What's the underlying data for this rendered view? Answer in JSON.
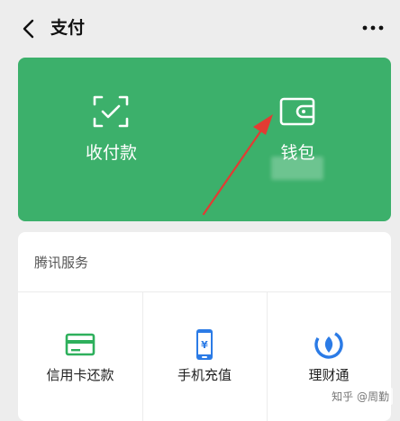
{
  "header": {
    "title": "支付"
  },
  "pay_card": {
    "items": [
      {
        "label": "收付款",
        "icon": "scan-code-icon"
      },
      {
        "label": "钱包",
        "icon": "wallet-icon"
      }
    ],
    "background": "#3cb06b"
  },
  "services": {
    "section_title": "腾讯服务",
    "items": [
      {
        "label": "信用卡还款",
        "icon": "credit-card-icon",
        "color": "#2eb05c"
      },
      {
        "label": "手机充值",
        "icon": "phone-topup-icon",
        "color": "#2b7be6"
      },
      {
        "label": "理财通",
        "icon": "wealth-icon",
        "color": "#2b7be6"
      }
    ]
  },
  "annotation": {
    "color": "#e23b33"
  },
  "watermark": {
    "text": "知乎 @周勤"
  }
}
